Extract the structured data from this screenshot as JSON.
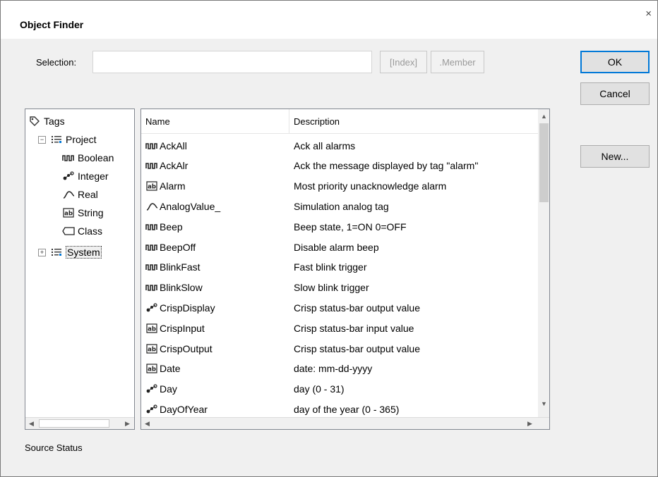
{
  "dialog": {
    "title": "Object Finder",
    "close_glyph": "×"
  },
  "selection": {
    "label": "Selection:",
    "value": "",
    "index_btn": "[Index]",
    "member_btn": ".Member"
  },
  "buttons": {
    "ok": "OK",
    "cancel": "Cancel",
    "new": "New..."
  },
  "tree": {
    "root": "Tags",
    "project": {
      "label": "Project",
      "expander": "−"
    },
    "project_children": [
      {
        "icon": "boolean-icon",
        "label": "Boolean"
      },
      {
        "icon": "integer-icon",
        "label": "Integer"
      },
      {
        "icon": "real-icon",
        "label": "Real"
      },
      {
        "icon": "string-icon",
        "label": "String"
      },
      {
        "icon": "class-icon",
        "label": "Class"
      }
    ],
    "system": {
      "label": "System",
      "expander": "+"
    }
  },
  "list": {
    "columns": [
      "Name",
      "Description"
    ],
    "rows": [
      {
        "icon": "boolean-icon",
        "name": "AckAll",
        "desc": "Ack all alarms"
      },
      {
        "icon": "boolean-icon",
        "name": "AckAlr",
        "desc": "Ack the message displayed by tag \"alarm\""
      },
      {
        "icon": "string-icon",
        "name": "Alarm",
        "desc": "Most priority unacknowledge alarm"
      },
      {
        "icon": "real-icon",
        "name": "AnalogValue_",
        "desc": "Simulation analog tag"
      },
      {
        "icon": "boolean-icon",
        "name": "Beep",
        "desc": "Beep state, 1=ON  0=OFF"
      },
      {
        "icon": "boolean-icon",
        "name": "BeepOff",
        "desc": "Disable alarm beep"
      },
      {
        "icon": "boolean-icon",
        "name": "BlinkFast",
        "desc": "Fast blink trigger"
      },
      {
        "icon": "boolean-icon",
        "name": "BlinkSlow",
        "desc": "Slow blink trigger"
      },
      {
        "icon": "integer-icon",
        "name": "CrispDisplay",
        "desc": "Crisp status-bar output value"
      },
      {
        "icon": "string-icon",
        "name": "CrispInput",
        "desc": "Crisp status-bar input value"
      },
      {
        "icon": "string-icon",
        "name": "CrispOutput",
        "desc": "Crisp status-bar output value"
      },
      {
        "icon": "string-icon",
        "name": "Date",
        "desc": "date: mm-dd-yyyy"
      },
      {
        "icon": "integer-icon",
        "name": "Day",
        "desc": "day (0 - 31)"
      },
      {
        "icon": "integer-icon",
        "name": "DayOfYear",
        "desc": "day of the year (0 - 365)"
      }
    ]
  },
  "status_text": "Source Status",
  "colors": {
    "focus_border": "#0078d7",
    "dialog_bg": "#f0f0f0",
    "list_border": "#828790"
  }
}
